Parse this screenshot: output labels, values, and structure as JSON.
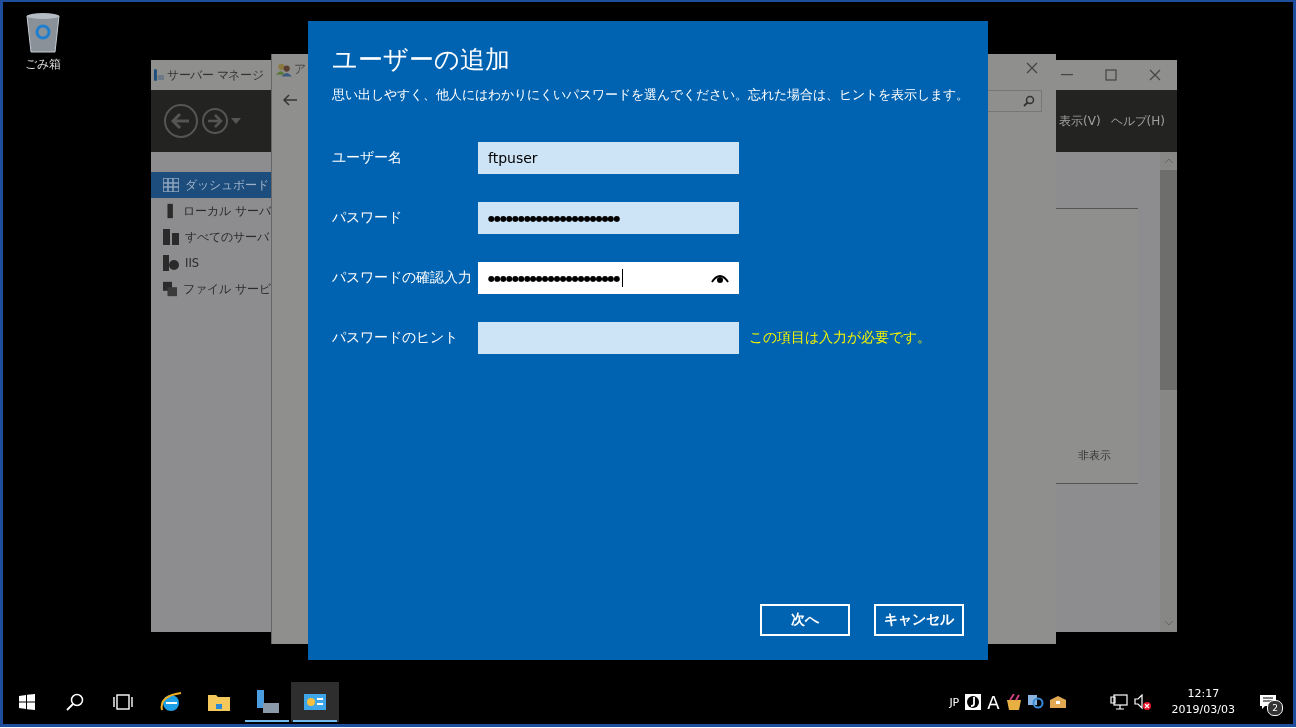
{
  "desktop_icons": [
    {
      "label": "ごみ箱",
      "kind": "recycle_bin"
    }
  ],
  "server_manager": {
    "title": "サーバー マネージ",
    "menu": [
      "表示(V)",
      "ヘルプ(H)"
    ],
    "nav": [
      {
        "label": "ダッシュボード",
        "kind": "dashboard",
        "selected": true
      },
      {
        "label": "ローカル サーバ",
        "kind": "server",
        "selected": false
      },
      {
        "label": "すべてのサーバ",
        "kind": "servers",
        "selected": false
      },
      {
        "label": "IIS",
        "kind": "iis",
        "selected": false
      },
      {
        "label": "ファイル サービ",
        "kind": "files",
        "selected": false
      }
    ],
    "panel_button": "非表示"
  },
  "accounts_window": {
    "title": "ア"
  },
  "dialog": {
    "title": "ユーザーの追加",
    "subtitle": "思い出しやすく、他人にはわかりにくいパスワードを選んでください。忘れた場合は、ヒントを表示します。",
    "fields": [
      {
        "label": "ユーザー名",
        "kind": "text",
        "value": "ftpuser",
        "focused": false,
        "reveal_button": false
      },
      {
        "label": "パスワード",
        "kind": "password",
        "value": "●●●●●●●●●●●●●●●●●●●●●●",
        "focused": false,
        "reveal_button": false
      },
      {
        "label": "パスワードの確認入力",
        "kind": "password",
        "value": "●●●●●●●●●●●●●●●●●●●●●●",
        "focused": true,
        "reveal_button": true
      },
      {
        "label": "パスワードのヒント",
        "kind": "text",
        "focused": false,
        "reveal_button": false,
        "error": "この項目は入力が必要です。"
      }
    ],
    "buttons": [
      "次へ",
      "キャンセル"
    ]
  },
  "taskbar": {
    "apps": [
      {
        "kind": "start",
        "running": false,
        "active": false
      },
      {
        "kind": "search",
        "running": false,
        "active": false
      },
      {
        "kind": "task_view",
        "running": false,
        "active": false
      },
      {
        "kind": "browser",
        "running": false,
        "active": false
      },
      {
        "kind": "folder",
        "running": false,
        "active": false
      },
      {
        "kind": "server_manager",
        "running": true,
        "active": false
      },
      {
        "kind": "control_panel",
        "running": true,
        "active": true
      }
    ],
    "tray": {
      "language": "JP",
      "ime_mode": "A",
      "time": "12:17",
      "date": "2019/03/03",
      "notification_count": "2"
    }
  }
}
